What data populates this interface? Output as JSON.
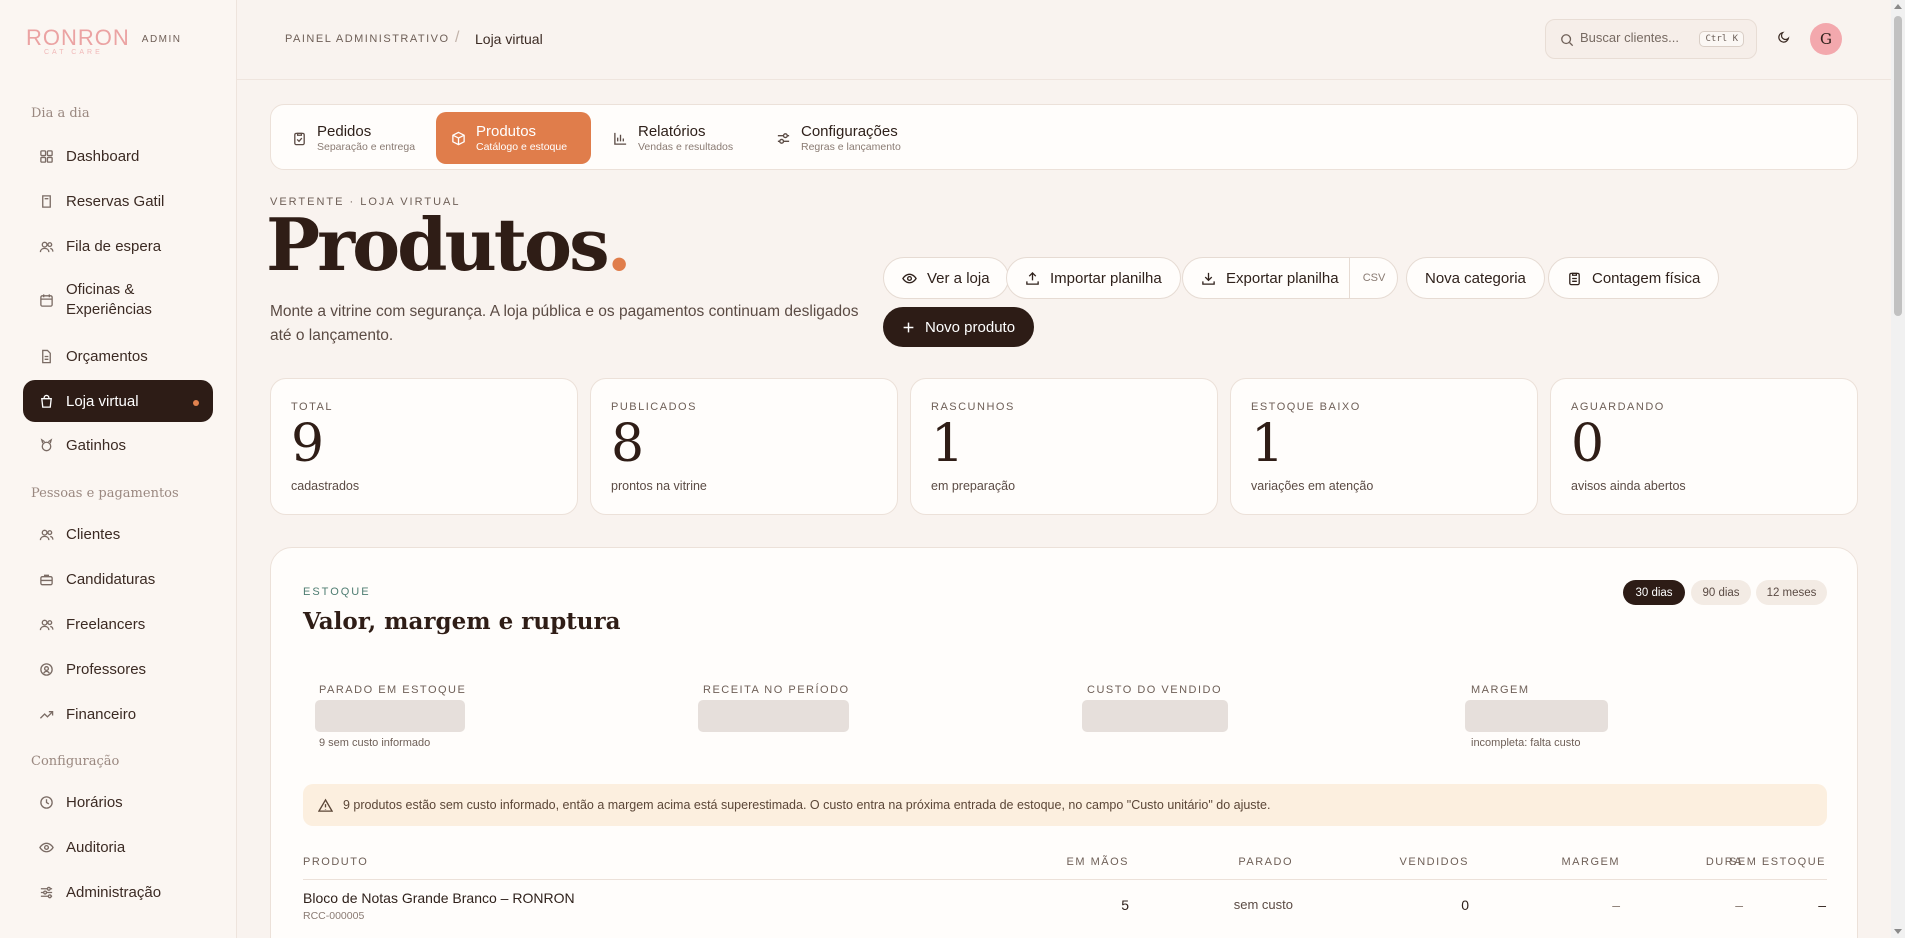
{
  "brand": {
    "logo": "RONRON",
    "subtitle": "CAT CARE",
    "badge": "ADMIN"
  },
  "sidebar": {
    "sections": [
      {
        "title": "Dia a dia"
      },
      {
        "title": "Pessoas e pagamentos"
      },
      {
        "title": "Configuração"
      }
    ],
    "items": [
      {
        "label": "Dashboard",
        "icon": "grid-icon"
      },
      {
        "label": "Reservas Gatil",
        "icon": "book-icon"
      },
      {
        "label": "Fila de espera",
        "icon": "users-icon"
      },
      {
        "label": "Oficinas & Experiências",
        "icon": "calendar-icon"
      },
      {
        "label": "Orçamentos",
        "icon": "document-icon"
      },
      {
        "label": "Loja virtual",
        "icon": "shopping-bag-icon",
        "active": true
      },
      {
        "label": "Gatinhos",
        "icon": "cat-icon"
      },
      {
        "label": "Clientes",
        "icon": "users-icon"
      },
      {
        "label": "Candidaturas",
        "icon": "briefcase-icon"
      },
      {
        "label": "Freelancers",
        "icon": "users-icon"
      },
      {
        "label": "Professores",
        "icon": "badge-icon"
      },
      {
        "label": "Financeiro",
        "icon": "trending-up-icon"
      },
      {
        "label": "Horários",
        "icon": "clock-icon"
      },
      {
        "label": "Auditoria",
        "icon": "eye-icon"
      },
      {
        "label": "Administração",
        "icon": "sliders-icon"
      }
    ]
  },
  "header": {
    "breadcrumb_root": "PAINEL ADMINISTRATIVO",
    "breadcrumb_sep": "/",
    "breadcrumb_current": "Loja virtual",
    "search_placeholder": "Buscar clientes...",
    "search_shortcut": "Ctrl K",
    "avatar_initial": "G"
  },
  "tabs": [
    {
      "label": "Pedidos",
      "sub": "Separação e entrega",
      "icon": "clipboard-icon"
    },
    {
      "label": "Produtos",
      "sub": "Catálogo e estoque",
      "icon": "box-icon",
      "active": true
    },
    {
      "label": "Relatórios",
      "sub": "Vendas e resultados",
      "icon": "bar-chart-icon"
    },
    {
      "label": "Configurações",
      "sub": "Regras e lançamento",
      "icon": "settings-sliders-icon"
    }
  ],
  "page": {
    "eyebrow": "VERTENTE · LOJA VIRTUAL",
    "title": "Produtos",
    "title_dot": ".",
    "description": "Monte a vitrine com segurança. A loja pública e os pagamentos continuam desligados até o lançamento."
  },
  "actions": {
    "view_store": "Ver a loja",
    "import": "Importar planilha",
    "export": "Exportar planilha",
    "export_format": "CSV",
    "new_category": "Nova categoria",
    "physical_count": "Contagem física",
    "new_product": "Novo produto"
  },
  "stats": [
    {
      "label": "TOTAL",
      "value": "9",
      "sub": "cadastrados"
    },
    {
      "label": "PUBLICADOS",
      "value": "8",
      "sub": "prontos na vitrine"
    },
    {
      "label": "RASCUNHOS",
      "value": "1",
      "sub": "em preparação"
    },
    {
      "label": "ESTOQUE BAIXO",
      "value": "1",
      "sub": "variações em atenção"
    },
    {
      "label": "AGUARDANDO",
      "value": "0",
      "sub": "avisos ainda abertos"
    }
  ],
  "inventory": {
    "eyebrow": "ESTOQUE",
    "title": "Valor, margem e ruptura",
    "ranges": [
      "30 dias",
      "90 dias",
      "12 meses"
    ],
    "active_range": "30 dias",
    "metrics": [
      {
        "label": "PARADO EM ESTOQUE",
        "note": "9 sem custo informado"
      },
      {
        "label": "RECEITA NO PERÍODO",
        "note": ""
      },
      {
        "label": "CUSTO DO VENDIDO",
        "note": ""
      },
      {
        "label": "MARGEM",
        "note": "incompleta: falta custo"
      }
    ],
    "alert": "9 produtos estão sem custo informado, então a margem acima está superestimada. O custo entra na próxima entrada de estoque, no campo \"Custo unitário\" do ajuste.",
    "columns": [
      "PRODUTO",
      "EM MÃOS",
      "PARADO",
      "VENDIDOS",
      "MARGEM",
      "DURA",
      "SEM ESTOQUE"
    ],
    "rows": [
      {
        "name": "Bloco de Notas Grande Branco – RONRON",
        "sku": "RCC-000005",
        "on_hand": "5",
        "idle": "sem custo",
        "sold": "0",
        "margin": "–",
        "lasts": "–",
        "out_of_stock": "–"
      }
    ]
  },
  "colors": {
    "accent": "#e07d4b",
    "dark": "#2d1c16",
    "brand_pink": "#eba3a3",
    "teal_label": "#4f7d72",
    "alert_bg": "#fcefdf"
  }
}
